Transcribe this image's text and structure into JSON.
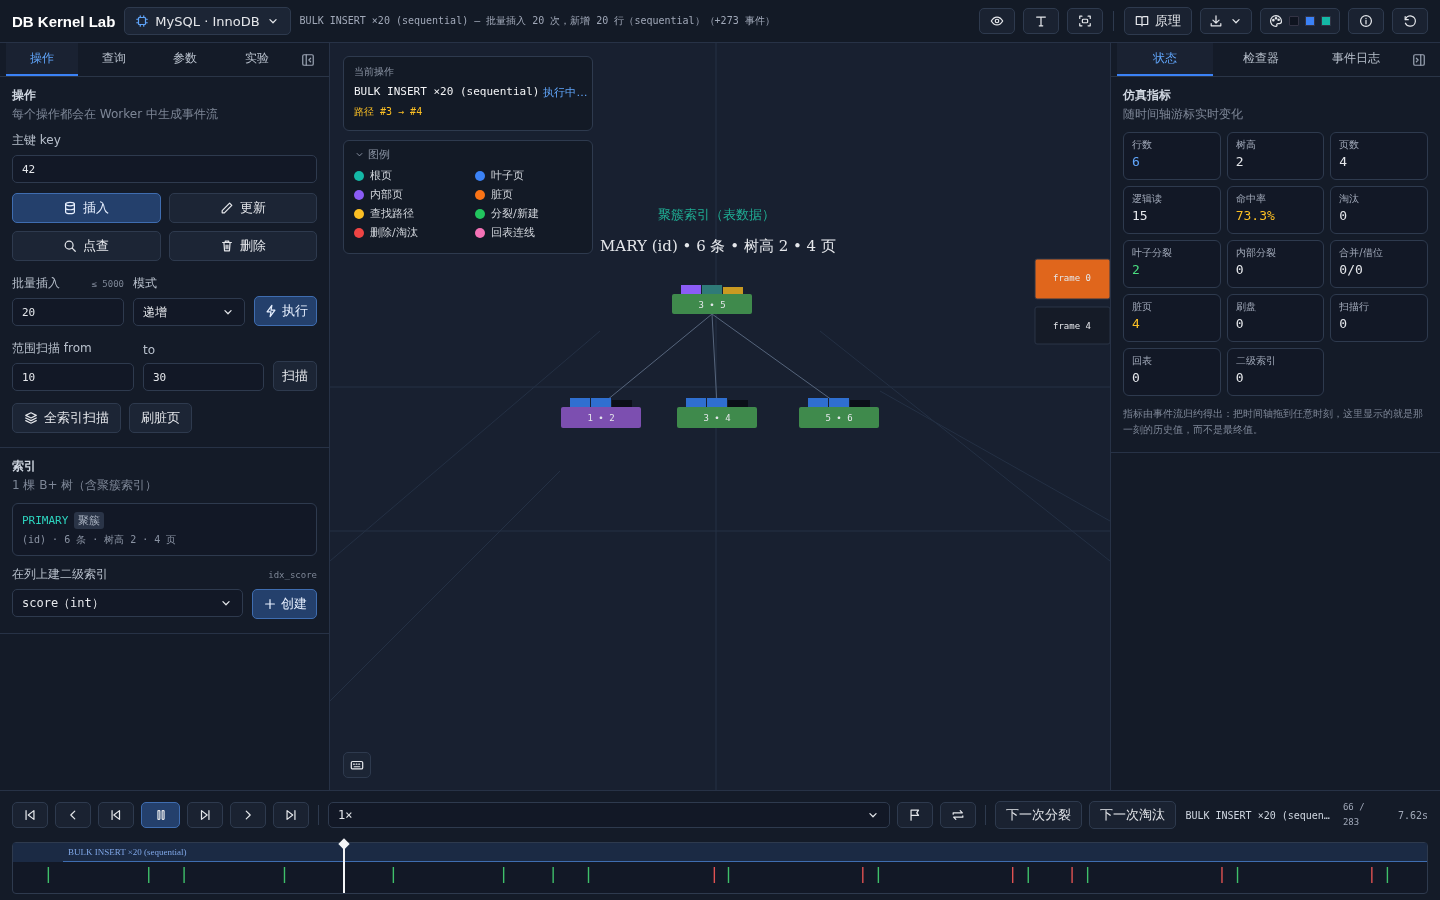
{
  "topbar": {
    "logo": "DB Kernel Lab",
    "engine": "MySQL · InnoDB",
    "status": "BULK INSERT ×20 (sequential) — 批量插入 20 次，新增 20 行（sequential）（+273 事件）",
    "principle_button": "原理"
  },
  "left_panel": {
    "tabs": [
      {
        "label": "操作",
        "selected": true
      },
      {
        "label": "查询",
        "selected": false
      },
      {
        "label": "参数",
        "selected": false
      },
      {
        "label": "实验",
        "selected": false
      }
    ],
    "ops": {
      "title": "操作",
      "subtitle": "每个操作都会在 Worker 中生成事件流",
      "key_label": "主键 key",
      "key_value": "42",
      "buttons": [
        {
          "label": "插入",
          "kind": "database",
          "selected": true
        },
        {
          "label": "更新",
          "kind": "pencil",
          "selected": false
        },
        {
          "label": "点查",
          "kind": "search",
          "selected": false
        },
        {
          "label": "删除",
          "kind": "trash",
          "selected": false
        }
      ]
    },
    "bulk": {
      "label": "批量插入",
      "limit": "≤ 5000",
      "mode_label": "模式",
      "count": "20",
      "mode": "递增",
      "run_button": "执行"
    },
    "range": {
      "from_label": "范围扫描 from",
      "to_label": "to",
      "from": "10",
      "to": "30",
      "scan_button": "扫描"
    },
    "full_scan_button": "全索引扫描",
    "flush_button": "刷脏页",
    "index": {
      "title": "索引",
      "subtitle": "1 棵 B+ 树（含聚簇索引）",
      "indexes": [
        {
          "name": "PRIMARY",
          "badge": "聚簇",
          "detail": "(id) · 6 条 · 树高 2 · 4 页"
        }
      ],
      "secondary_label": "在列上建二级索引",
      "secondary_name": "idx_score",
      "column": "score（int）",
      "create_button": "创建"
    }
  },
  "canvas": {
    "current_op": {
      "label": "当前操作",
      "op": "BULK INSERT ×20 (sequential)",
      "state": "执行中…",
      "path": "路径 #3 → #4"
    },
    "legend": {
      "title": "图例",
      "expanded": true,
      "items": [
        {
          "label": "根页",
          "color": "#14b8a6"
        },
        {
          "label": "叶子页",
          "color": "#3b82f6"
        },
        {
          "label": "内部页",
          "color": "#8b5cf6"
        },
        {
          "label": "脏页",
          "color": "#f97316"
        },
        {
          "label": "查找路径",
          "color": "#fbbf24"
        },
        {
          "label": "分裂/新建",
          "color": "#22c55e"
        },
        {
          "label": "删除/淘汰",
          "color": "#ef4444"
        },
        {
          "label": "回表连线",
          "color": "#f472b6"
        }
      ]
    },
    "tree_title": "聚簇索引（表数据）",
    "tree_subtitle": "MARY (id) • 6 条 • 树高 2 • 4 页",
    "root": {
      "keys": "3 • 5",
      "color": "#3f8a4c"
    },
    "leaves": [
      {
        "keys": "1 • 2",
        "color": "#7c4fb0"
      },
      {
        "keys": "3 • 4",
        "color": "#3f8a4c"
      },
      {
        "keys": "5 • 6",
        "color": "#3f8a4c"
      }
    ],
    "frames": [
      {
        "label": "frame 0",
        "color": "#e0661c"
      },
      {
        "label": "frame 4",
        "color": "#151b27"
      }
    ]
  },
  "right_panel": {
    "tabs": [
      {
        "label": "状态",
        "selected": true
      },
      {
        "label": "检查器",
        "selected": false
      },
      {
        "label": "事件日志",
        "selected": false
      }
    ],
    "title": "仿真指标",
    "subtitle": "随时间轴游标实时变化",
    "metrics": [
      {
        "label": "行数",
        "value": "6",
        "color": "#60a5fa"
      },
      {
        "label": "树高",
        "value": "2",
        "color": "#e5e7eb"
      },
      {
        "label": "页数",
        "value": "4",
        "color": "#e5e7eb"
      },
      {
        "label": "逻辑读",
        "value": "15",
        "color": "#e5e7eb"
      },
      {
        "label": "命中率",
        "value": "73.3%",
        "color": "#fbbf24"
      },
      {
        "label": "淘汰",
        "value": "0",
        "color": "#e5e7eb"
      },
      {
        "label": "叶子分裂",
        "value": "2",
        "color": "#4ade80"
      },
      {
        "label": "内部分裂",
        "value": "0",
        "color": "#e5e7eb"
      },
      {
        "label": "合并/借位",
        "value": "0/0",
        "color": "#e5e7eb"
      },
      {
        "label": "脏页",
        "value": "4",
        "color": "#fbbf24"
      },
      {
        "label": "刷盘",
        "value": "0",
        "color": "#e5e7eb"
      },
      {
        "label": "扫描行",
        "value": "0",
        "color": "#e5e7eb"
      },
      {
        "label": "回表",
        "value": "0",
        "color": "#e5e7eb"
      },
      {
        "label": "二级索引",
        "value": "0",
        "color": "#e5e7eb"
      }
    ],
    "note": "指标由事件流归约得出：把时间轴拖到任意时刻，这里显示的就是那一刻的历史值，而不是最终值。"
  },
  "timeline": {
    "playing": true,
    "speed": "1×",
    "next_split": "下一次分裂",
    "next_evict": "下一次淘汰",
    "op": "BULK INSERT ×20 (sequen…",
    "position": "66 / 283",
    "time": "7.62s",
    "track_label": "BULK INSERT ×20 (sequential)",
    "level": 0.234
  }
}
